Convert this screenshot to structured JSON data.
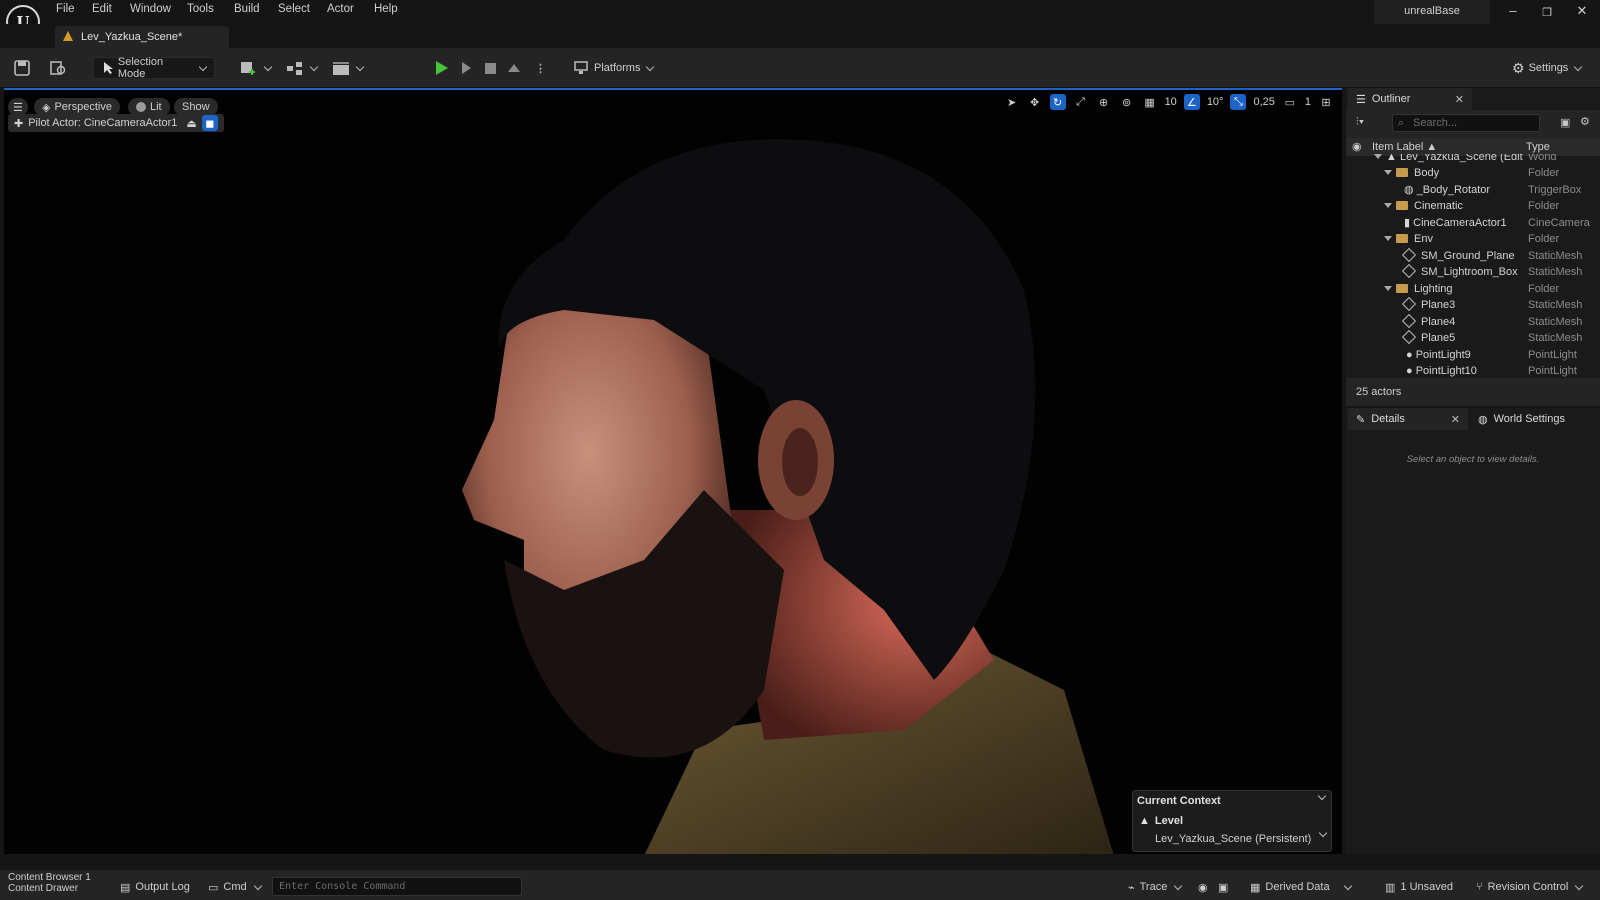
{
  "menu": {
    "items": [
      "File",
      "Edit",
      "Window",
      "Tools",
      "Build",
      "Select",
      "Actor",
      "Help"
    ]
  },
  "window": {
    "project_name": "unrealBase",
    "min_glyph": "–",
    "restore_glyph": "❐",
    "close_glyph": "✕",
    "logo_text": "U"
  },
  "level_tab": {
    "label": "Lev_Yazkua_Scene*"
  },
  "toolbar": {
    "selection_mode": "Selection Mode",
    "platforms": "Platforms",
    "settings": "Settings"
  },
  "viewport": {
    "perspective": "Perspective",
    "lit": "Lit",
    "show": "Show",
    "pilot_actor": "Pilot Actor: CineCameraActor1",
    "grid_snap": "10",
    "rotation_snap": "10°",
    "scale_snap": "0,25",
    "camera_speed": "1"
  },
  "context": {
    "title": "Current Context",
    "level_label": "Level",
    "level_value": "Lev_Yazkua_Scene (Persistent)"
  },
  "outliner": {
    "tab": "Outliner",
    "search_placeholder": "Search...",
    "col_label": "Item Label ▲",
    "col_type": "Type",
    "rows": [
      {
        "label": "Lev_Yazkua_Scene (Edit",
        "type": "World"
      },
      {
        "label": "Body",
        "type": "Folder"
      },
      {
        "label": "_Body_Rotator",
        "type": "TriggerBox"
      },
      {
        "label": "Cinematic",
        "type": "Folder"
      },
      {
        "label": "CineCameraActor1",
        "type": "CineCamera"
      },
      {
        "label": "Env",
        "type": "Folder"
      },
      {
        "label": "SM_Ground_Plane",
        "type": "StaticMesh"
      },
      {
        "label": "SM_Lightroom_Box",
        "type": "StaticMesh"
      },
      {
        "label": "Lighting",
        "type": "Folder"
      },
      {
        "label": "Plane3",
        "type": "StaticMesh"
      },
      {
        "label": "Plane4",
        "type": "StaticMesh"
      },
      {
        "label": "Plane5",
        "type": "StaticMesh"
      },
      {
        "label": "PointLight9",
        "type": "PointLight"
      },
      {
        "label": "PointLight10",
        "type": "PointLight"
      }
    ],
    "footer": "25 actors"
  },
  "details": {
    "tab": "Details",
    "world_tab": "World Settings",
    "empty": "Select an object to view details."
  },
  "statusbar": {
    "content_browser": "Content Browser 1",
    "content_drawer": "Content Drawer",
    "output_log": "Output Log",
    "cmd": "Cmd",
    "console_placeholder": "Enter Console Command",
    "trace": "Trace",
    "derived_data": "Derived Data",
    "unsaved": "1 Unsaved",
    "revision_control": "Revision Control"
  },
  "colors": {
    "accent": "#1c64c8",
    "play": "#46c33a",
    "folder": "#c89b4c"
  }
}
